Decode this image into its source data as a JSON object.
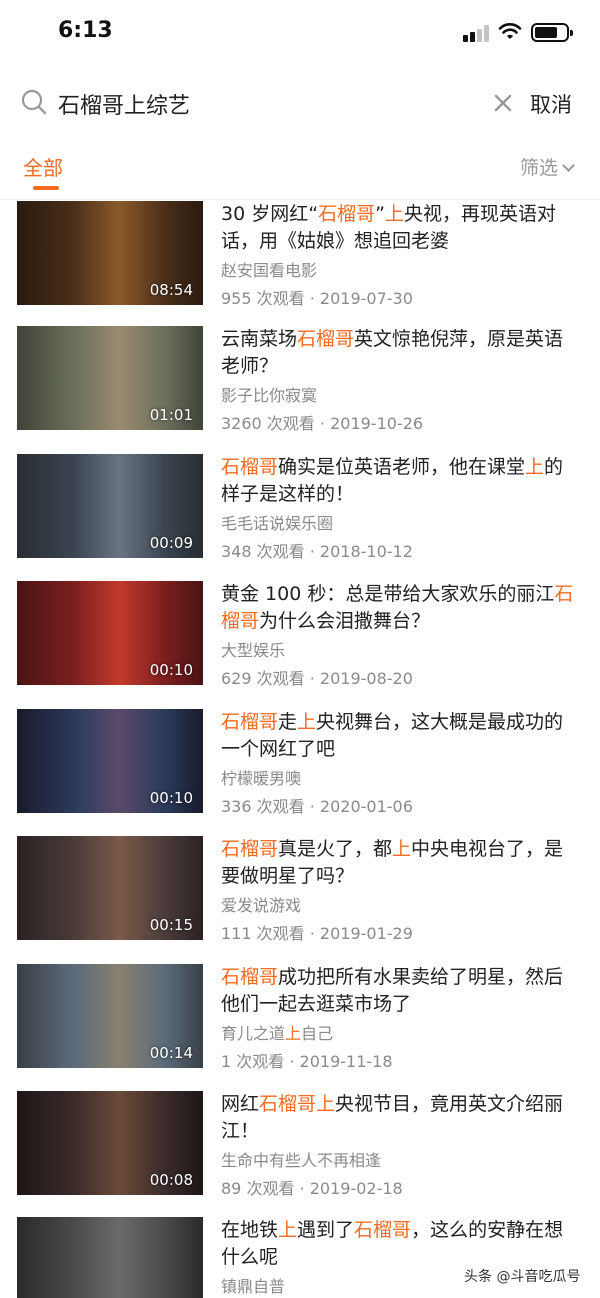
{
  "status": {
    "time": "6:13"
  },
  "search": {
    "query": "石榴哥上综艺",
    "cancel_label": "取消"
  },
  "tabs": {
    "all_label": "全部",
    "filter_label": "筛选"
  },
  "results": [
    {
      "title_parts": [
        [
          "30 岁网红“",
          false
        ],
        [
          "石榴哥",
          true
        ],
        [
          "”",
          false
        ],
        [
          "上",
          true
        ],
        [
          "央视，再现英语对话，用《姑娘》想追回老婆",
          false
        ]
      ],
      "author": "赵安国看电影",
      "views": "955 次观看",
      "date": "2019-07-30",
      "duration": "08:54",
      "thumb_colors": [
        "#4a2e1a",
        "#8a5a2a",
        "#2a1a10"
      ]
    },
    {
      "title_parts": [
        [
          "云南菜场",
          false
        ],
        [
          "石榴哥",
          true
        ],
        [
          "英文惊艳倪萍，原是英语老师？",
          false
        ]
      ],
      "author": "影子比你寂寞",
      "views": "3260 次观看",
      "date": "2019-10-26",
      "duration": "01:01",
      "thumb_colors": [
        "#6b6f5a",
        "#9a8a70",
        "#3e4438"
      ]
    },
    {
      "title_parts": [
        [
          "石榴哥",
          true
        ],
        [
          "确实是位英语老师，他在课堂",
          false
        ],
        [
          "上",
          true
        ],
        [
          "的样子是这样的！",
          false
        ]
      ],
      "author": "毛毛话说娱乐圈",
      "views": "348 次观看",
      "date": "2018-10-12",
      "duration": "00:09",
      "thumb_colors": [
        "#3a4450",
        "#6a7480",
        "#2a2e34"
      ]
    },
    {
      "title_parts": [
        [
          "黄金 100 秒：总是带给大家欢乐的丽江",
          false
        ],
        [
          "石榴哥",
          true
        ],
        [
          "为什么会泪撒舞台？",
          false
        ]
      ],
      "author": "大型娱乐",
      "views": "629 次观看",
      "date": "2019-08-20",
      "duration": "00:10",
      "thumb_colors": [
        "#7a1e1e",
        "#c23a2a",
        "#4a1414"
      ]
    },
    {
      "title_parts": [
        [
          "石榴哥",
          true
        ],
        [
          "走",
          false
        ],
        [
          "上",
          true
        ],
        [
          "央视舞台，这大概是最成功的一个网红了吧",
          false
        ]
      ],
      "author": "柠檬暖男噢",
      "views": "336 次观看",
      "date": "2020-01-06",
      "duration": "00:10",
      "thumb_colors": [
        "#2a3a5a",
        "#5a4a6a",
        "#1a1a2a"
      ]
    },
    {
      "title_parts": [
        [
          "石榴哥",
          true
        ],
        [
          "真是火了，都",
          false
        ],
        [
          "上",
          true
        ],
        [
          "中央电视台了，是要做明星了吗？",
          false
        ]
      ],
      "author": "爱发说游戏",
      "views": "111 次观看",
      "date": "2019-01-29",
      "duration": "00:15",
      "thumb_colors": [
        "#4a3a3a",
        "#7a5a4a",
        "#2a2222"
      ]
    },
    {
      "title_parts": [
        [
          "石榴哥",
          true
        ],
        [
          "成功把所有水果卖给了明星，然后他们一起去逛菜市场了",
          false
        ]
      ],
      "author_parts": [
        [
          "育儿之道",
          false
        ],
        [
          "上",
          true
        ],
        [
          "自己",
          false
        ]
      ],
      "views": "1 次观看",
      "date": "2019-11-18",
      "duration": "00:14",
      "thumb_colors": [
        "#5a6a7a",
        "#8a8070",
        "#3a4048"
      ]
    },
    {
      "title_parts": [
        [
          "网红",
          false
        ],
        [
          "石榴哥上",
          true
        ],
        [
          "央视节目，竟用英文介绍丽江！",
          false
        ]
      ],
      "author": "生命中有些人不再相逢",
      "views": "89 次观看",
      "date": "2019-02-18",
      "duration": "00:08",
      "thumb_colors": [
        "#3a2a2a",
        "#6a4a3a",
        "#1e1616"
      ]
    },
    {
      "title_parts": [
        [
          "在地铁",
          false
        ],
        [
          "上",
          true
        ],
        [
          "遇到了",
          false
        ],
        [
          "石榴哥",
          true
        ],
        [
          "，这么的安静在想什么呢",
          false
        ]
      ],
      "author": "镇鼎自普",
      "views": "",
      "date": "",
      "duration": "",
      "thumb_colors": [
        "#4a4a4a",
        "#6a6a6a",
        "#2a2a2a"
      ]
    }
  ],
  "watermark": "头条 @斗音吃瓜号",
  "colors": {
    "accent": "#f26b21",
    "text": "#222222",
    "muted": "#8a8a8a"
  },
  "icons": [
    "search-icon",
    "clear-icon",
    "chevron-down-icon",
    "wifi-icon",
    "battery-icon",
    "signal-icon"
  ]
}
